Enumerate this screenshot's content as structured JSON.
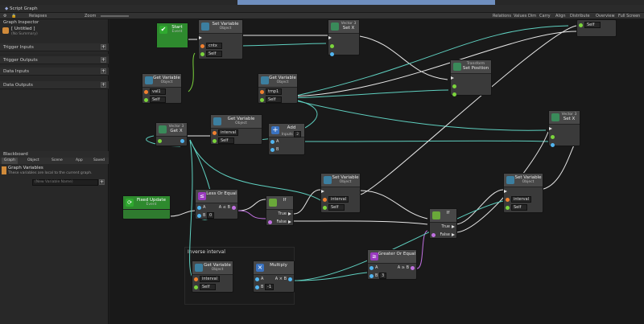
{
  "window": {
    "tab_title": "Script Graph",
    "inspector_title": "Graph Inspector"
  },
  "toolbar": {
    "left": "Relapses",
    "center": "Zoom",
    "right_items": [
      "Relations",
      "Values",
      "Dim",
      "Carry",
      "Align",
      "Distribute",
      "Overview",
      "Full Screen"
    ]
  },
  "sidebar": {
    "graph_title": "[ Untitled ]",
    "graph_summary": "(No Summary)",
    "sections": [
      "Trigger Inputs",
      "Trigger Outputs",
      "Data Inputs",
      "Data Outputs"
    ],
    "blackboard": {
      "title": "Blackboard",
      "tabs": [
        "Graph",
        "Object",
        "Scene",
        "App",
        "Saved"
      ],
      "heading": "Graph Variables",
      "hint": "These variables are local to the current graph.",
      "new_var_placeholder": "(New Variable Name)"
    }
  },
  "nodes": {
    "start": {
      "title": "Start",
      "sub": "Event"
    },
    "setvar1": {
      "title": "Set Variable",
      "scope": "Object",
      "name": "cntx",
      "self": "Self"
    },
    "setx1": {
      "title": "Set X",
      "sub": "Vector 3"
    },
    "getvar_val1": {
      "title": "Get Variable",
      "scope": "Object",
      "name": "val1",
      "self": "Self"
    },
    "getvar_tmp1": {
      "title": "Get Variable",
      "scope": "Object",
      "name": "tmp1",
      "self": "Self"
    },
    "transform": {
      "title": "Set Position",
      "sub": "Transform"
    },
    "getvar_topright": {
      "self": "Self"
    },
    "getx": {
      "title": "Get X",
      "sub": "Vector 3"
    },
    "getvar_interval1": {
      "title": "Get Variable",
      "scope": "Object",
      "name": "interval",
      "self": "Self"
    },
    "add": {
      "title": "Add",
      "sub": "Inputs",
      "count": "2",
      "a": "A",
      "b": "B"
    },
    "setx2": {
      "title": "Set X",
      "sub": "Vector 3"
    },
    "fixed": {
      "title": "Fixed Update",
      "sub": "Event"
    },
    "lte": {
      "title": "Less Or Equal",
      "a": "A",
      "b": "B",
      "b_val": "0",
      "out": "A ≤ B"
    },
    "if1": {
      "title": "If",
      "true": "True",
      "false": "False"
    },
    "setvar2": {
      "title": "Set Variable",
      "scope": "Object",
      "name": "interval",
      "self": "Self"
    },
    "if2": {
      "title": "If",
      "true": "True",
      "false": "False"
    },
    "setvar3": {
      "title": "Set Variable",
      "scope": "Object",
      "name": "interval",
      "self": "Self"
    },
    "gte": {
      "title": "Greater Or Equal",
      "a": "A",
      "b": "B",
      "b_val": "3",
      "out": "A ≥ B"
    },
    "mult": {
      "title": "Multiply",
      "a": "A",
      "b": "B",
      "b_val": "-1",
      "out": "A × B"
    },
    "getvar_interval2": {
      "title": "Get Variable",
      "scope": "Object",
      "name": "interval",
      "self": "Self"
    }
  },
  "group": {
    "title": "Inverse interval"
  },
  "colors": {
    "canvas": "#191919",
    "node": "#3a3a3a",
    "wire_flow": "#e6e6e6",
    "wire_float": "#5fd0c0",
    "wire_bool": "#c070e0",
    "pin_green": "#7bd43c",
    "pin_blue": "#52b5f0",
    "pin_orange": "#f08030",
    "pin_purple": "#c070e0"
  }
}
